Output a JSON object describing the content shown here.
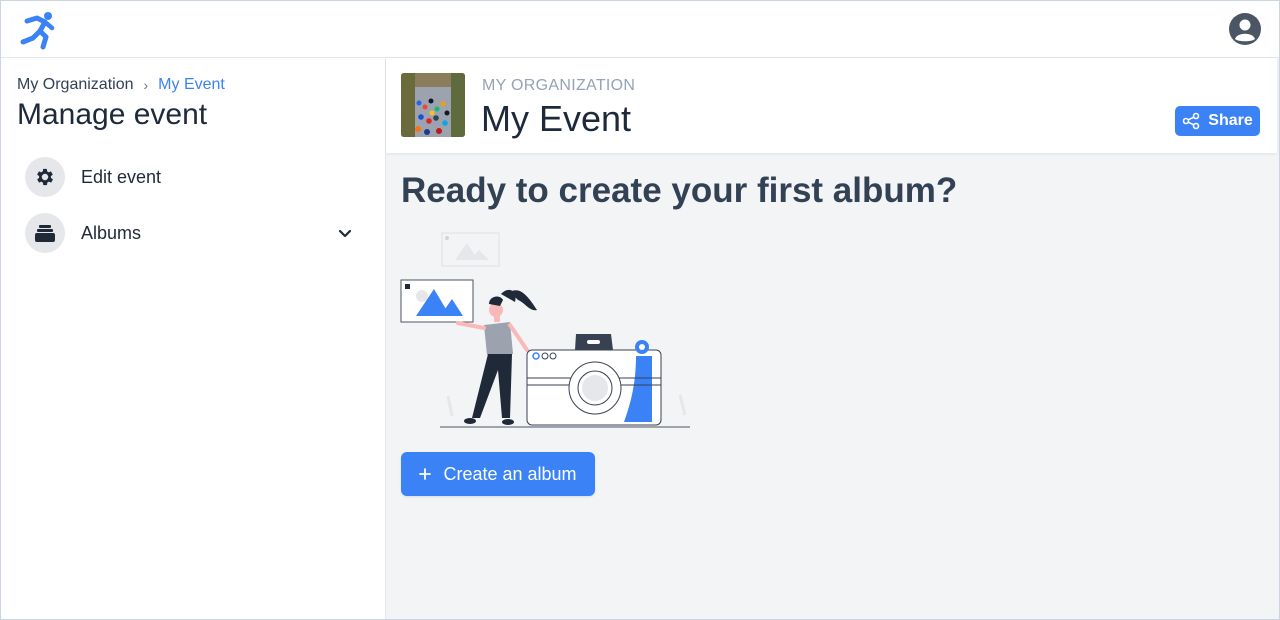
{
  "colors": {
    "accent": "#3b82f6",
    "text": "#334155",
    "muted": "#94a3b8",
    "background": "#f3f4f6"
  },
  "topbar": {
    "logo_icon": "running-person-icon",
    "profile_icon": "user-circle-icon"
  },
  "sidebar": {
    "breadcrumb": {
      "root": "My Organization",
      "separator": "›",
      "current": "My Event"
    },
    "title": "Manage event",
    "items": [
      {
        "label": "Edit event",
        "icon": "gear-icon"
      },
      {
        "label": "Albums",
        "icon": "albums-icon",
        "expand_icon": "chevron-down-icon"
      }
    ]
  },
  "event": {
    "organization": "MY ORGANIZATION",
    "name": "My Event",
    "share_label": "Share",
    "share_icon": "share-icon"
  },
  "main": {
    "heading": "Ready to create your first album?",
    "create_button_label": "Create an album",
    "create_button_icon": "plus-icon"
  }
}
